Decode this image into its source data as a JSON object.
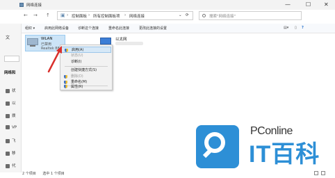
{
  "window": {
    "title": "网络连接",
    "min": "—",
    "max": "☐",
    "close": "✕"
  },
  "address": {
    "back": "←",
    "forward": "→",
    "up": "↑",
    "crumbs": [
      "控制面板",
      "所有控制面板项",
      "网络连接"
    ],
    "sep": "›",
    "dropdown": "⌄",
    "refresh": "⟳",
    "search_placeholder": "搜索\"网络连接\""
  },
  "toolbar": {
    "items": [
      "组织 ▾",
      "启用此网络设备",
      "诊断这个连接",
      "重命名此连接",
      "更改此连接的设置"
    ]
  },
  "sidebar": {
    "top_text": "文",
    "heading": "网络和",
    "items": [
      "状",
      "以",
      "拨",
      "VP",
      "飞",
      "移",
      "代"
    ]
  },
  "adapters": {
    "wlan": {
      "name": "WLAN",
      "status": "已禁用",
      "device": "Realtek 8822"
    },
    "ethernet": {
      "name": "以太网"
    }
  },
  "context_menu": {
    "items": [
      {
        "label": "启用(A)",
        "state": "hover"
      },
      {
        "label": "状态(U)",
        "state": "disabled"
      },
      {
        "label": "诊断(I)",
        "state": "normal"
      },
      {
        "label": "创建快捷方式(S)",
        "state": "normal"
      },
      {
        "label": "删除(D)",
        "state": "disabled"
      },
      {
        "label": "重命名(M)",
        "state": "normal"
      },
      {
        "label": "属性(R)",
        "state": "normal"
      }
    ]
  },
  "statusbar": {
    "count": "2 个项目",
    "selected": "选中 1 个项目"
  },
  "watermark": {
    "pc": "PConline",
    "brand": "IT百科"
  },
  "colors": {
    "accent": "#2d8fd6",
    "selection": "#cce4f7",
    "arrow": "#d9302c"
  }
}
